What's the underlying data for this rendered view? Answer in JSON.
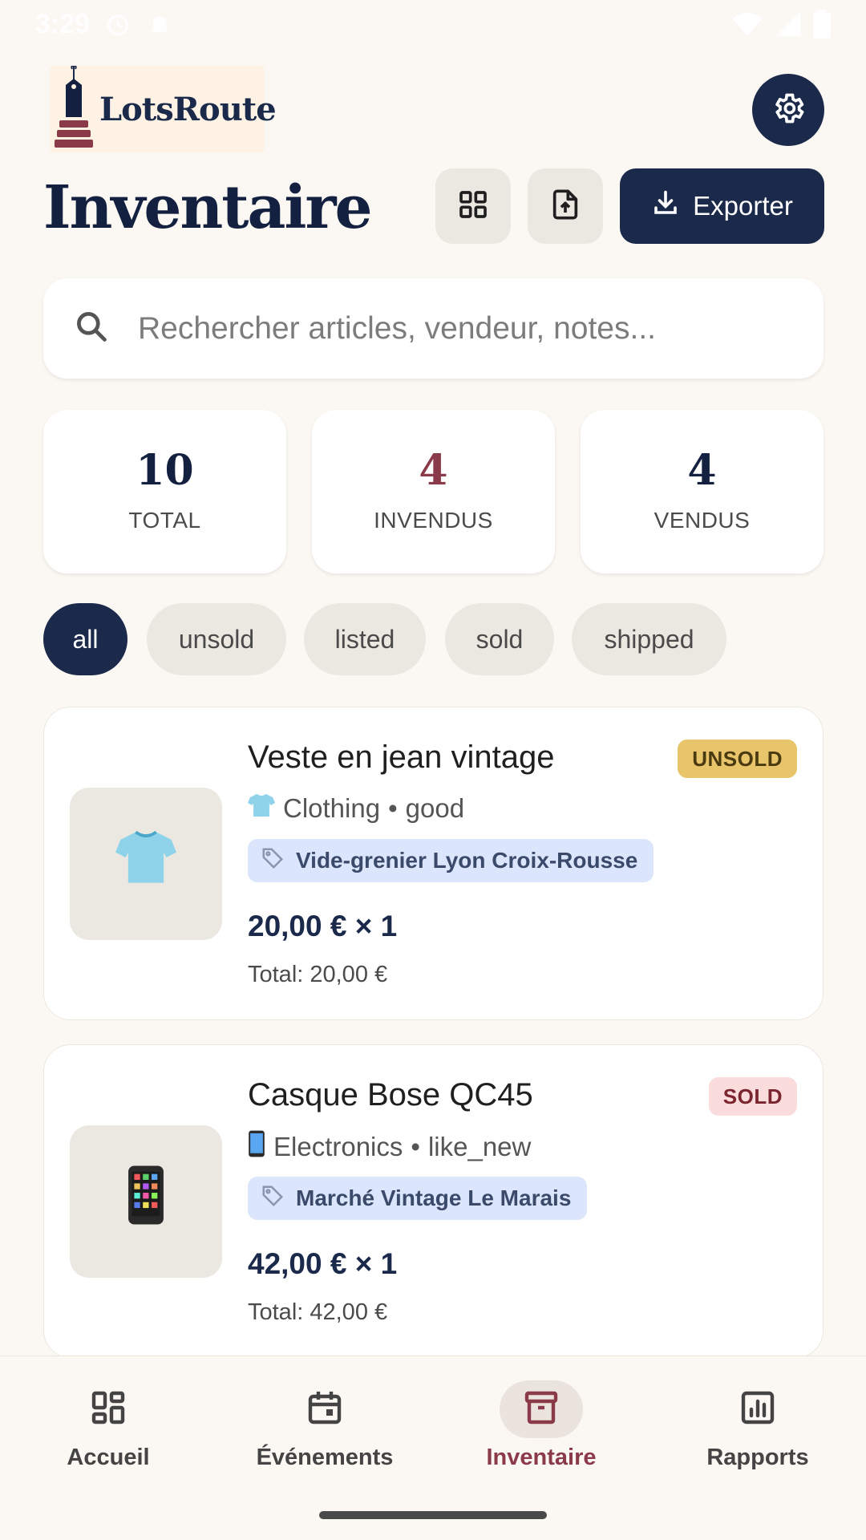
{
  "status_bar": {
    "time": "3:29"
  },
  "app": {
    "logo_text": "LotsRoute",
    "title": "Inventaire"
  },
  "toolbar": {
    "export_label": "Exporter"
  },
  "search": {
    "placeholder": "Rechercher articles, vendeur, notes..."
  },
  "stats": [
    {
      "value": "10",
      "label": "TOTAL",
      "color": "#13203f"
    },
    {
      "value": "4",
      "label": "INVENDUS",
      "color": "#8b3a4a"
    },
    {
      "value": "4",
      "label": "VENDUS",
      "color": "#13203f"
    }
  ],
  "filters": [
    {
      "label": "all",
      "active": true
    },
    {
      "label": "unsold",
      "active": false
    },
    {
      "label": "listed",
      "active": false
    },
    {
      "label": "sold",
      "active": false
    },
    {
      "label": "shipped",
      "active": false
    }
  ],
  "items": [
    {
      "title": "Veste en jean vintage",
      "category_icon": "tshirt-icon",
      "category": "Clothing",
      "condition": "good",
      "event": "Vide-grenier Lyon Croix-Rousse",
      "price": "20,00 € × 1",
      "total": "Total: 20,00 €",
      "status": "UNSOLD"
    },
    {
      "title": "Casque Bose QC45",
      "category_icon": "phone-icon",
      "category": "Electronics",
      "condition": "like_new",
      "event": "Marché Vintage Le Marais",
      "price": "42,00 € × 1",
      "total": "Total: 42,00 €",
      "status": "SOLD"
    }
  ],
  "bottom_nav": [
    {
      "label": "Accueil",
      "icon": "dashboard-icon",
      "active": false
    },
    {
      "label": "Événements",
      "icon": "calendar-icon",
      "active": false
    },
    {
      "label": "Inventaire",
      "icon": "archive-icon",
      "active": true
    },
    {
      "label": "Rapports",
      "icon": "chart-icon",
      "active": false
    }
  ],
  "colors": {
    "navy": "#1b2a4a",
    "accent": "#8b3a4a",
    "background": "#fbf8f3",
    "unsold_badge": "#e8c46a",
    "sold_badge": "#fbdcdc",
    "event_tag": "#dbe5fb"
  }
}
